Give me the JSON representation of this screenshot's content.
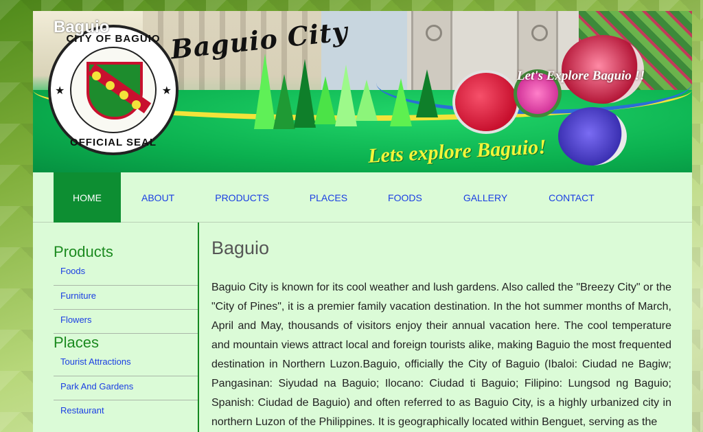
{
  "header": {
    "site_name": "Baguio",
    "logo_text": "Baguio City",
    "seal_top": "CITY OF BAGUIO",
    "seal_bottom": "OFFICIAL SEAL",
    "banner_tagline_top": "Let's Explore Baguio !!",
    "banner_tagline": "Lets explore Baguio!"
  },
  "nav": {
    "items": [
      {
        "label": "HOME",
        "active": true
      },
      {
        "label": "ABOUT"
      },
      {
        "label": "PRODUCTS"
      },
      {
        "label": "PLACES"
      },
      {
        "label": "FOODS"
      },
      {
        "label": "GALLERY"
      },
      {
        "label": "CONTACT"
      }
    ]
  },
  "sidebar": {
    "sections": [
      {
        "title": "Products",
        "links": [
          "Foods",
          "Furniture",
          "Flowers"
        ]
      },
      {
        "title": "Places",
        "links": [
          "Tourist Attractions",
          "Park And Gardens",
          "Restaurant"
        ]
      }
    ]
  },
  "main": {
    "title": "Baguio",
    "body": "Baguio City is known for its cool weather and lush gardens. Also called the \"Breezy City\" or the \"City of Pines\", it is a premier family vacation destination. In the hot summer months of March, April and May, thousands of visitors enjoy their annual vacation here. The cool temperature and mountain views attract local and foreign tourists alike, making Baguio the most frequented destination in Northern Luzon.Baguio, officially the City of Baguio (Ibaloi: Ciudad ne Bagiw; Pangasinan: Siyudad na Baguio; Ilocano: Ciudad ti Baguio; Filipino: Lungsod ng Baguio; Spanish: Ciudad de Baguio) and often referred to as Baguio City, is a highly urbanized city in northern Luzon of the Philippines. It is geographically located within Benguet, serving as the"
  },
  "colors": {
    "nav_active_bg": "#0d8e32",
    "link": "#1a3ee3",
    "heading_green": "#1b8a1f",
    "page_bg": "#dbfbd7"
  }
}
